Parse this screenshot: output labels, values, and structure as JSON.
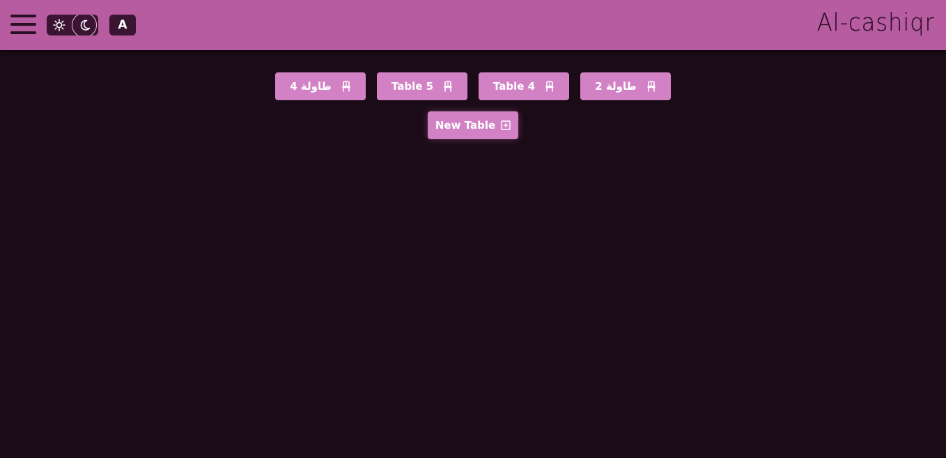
{
  "header": {
    "logo_text": "Al-cashiqr",
    "language_label": "A",
    "icons": [
      "hamburger-icon",
      "sun-icon",
      "moon-icon"
    ]
  },
  "tables": [
    {
      "label": "طاولة 4",
      "icon": "chair-icon"
    },
    {
      "label": "Table 5",
      "icon": "chair-icon"
    },
    {
      "label": "Table 4",
      "icon": "chair-icon"
    },
    {
      "label": "طاولة 2",
      "icon": "chair-icon"
    }
  ],
  "new_table": {
    "label": "New Table",
    "icon": "plus-square-icon"
  },
  "colors": {
    "header_bg": "#b75ca1",
    "page_bg": "#1b0b17",
    "button_bg": "#d282c4",
    "toggle_bg": "#3c1433"
  }
}
